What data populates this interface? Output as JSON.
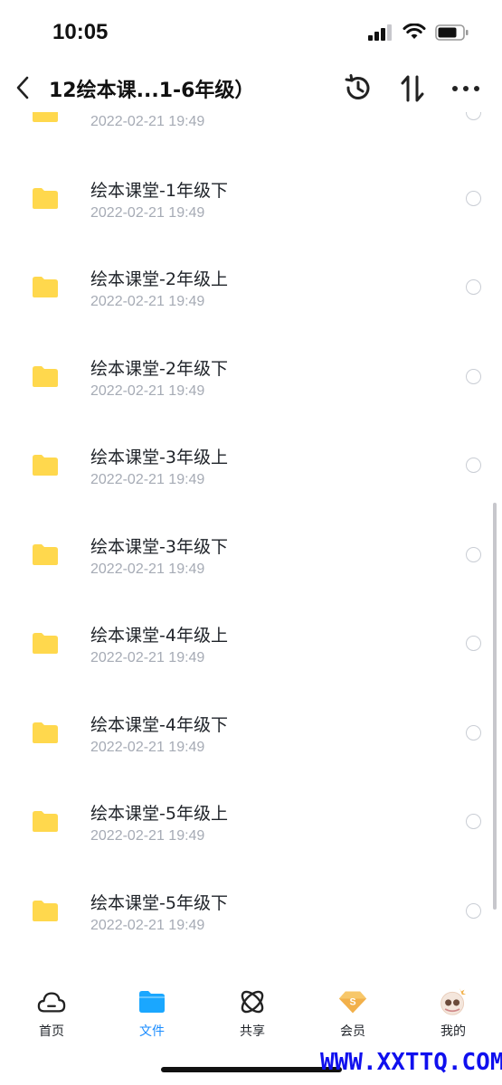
{
  "status_bar": {
    "time": "10:05"
  },
  "header": {
    "title": "12绘本课...1-6年级）"
  },
  "partial_item": {
    "date": "2022-02-21 19:49"
  },
  "files": [
    {
      "name": "绘本课堂-1年级下",
      "date": "2022-02-21 19:49"
    },
    {
      "name": "绘本课堂-2年级上",
      "date": "2022-02-21 19:49"
    },
    {
      "name": "绘本课堂-2年级下",
      "date": "2022-02-21 19:49"
    },
    {
      "name": "绘本课堂-3年级上",
      "date": "2022-02-21 19:49"
    },
    {
      "name": "绘本课堂-3年级下",
      "date": "2022-02-21 19:49"
    },
    {
      "name": "绘本课堂-4年级上",
      "date": "2022-02-21 19:49"
    },
    {
      "name": "绘本课堂-4年级下",
      "date": "2022-02-21 19:49"
    },
    {
      "name": "绘本课堂-5年级上",
      "date": "2022-02-21 19:49"
    },
    {
      "name": "绘本课堂-5年级下",
      "date": "2022-02-21 19:49"
    }
  ],
  "tabs": [
    {
      "label": "首页",
      "icon": "cloud-icon",
      "active": false
    },
    {
      "label": "文件",
      "icon": "folder-icon",
      "active": true
    },
    {
      "label": "共享",
      "icon": "orbit-icon",
      "active": false
    },
    {
      "label": "会员",
      "icon": "diamond-icon",
      "active": false
    },
    {
      "label": "我的",
      "icon": "avatar",
      "active": false
    }
  ],
  "watermark": "WWW.XXTTQ.COM",
  "colors": {
    "accent": "#1a8cff",
    "folder": "#ffd84d",
    "date_text": "#a6abb5",
    "vip_gold": "#f2b04a"
  }
}
